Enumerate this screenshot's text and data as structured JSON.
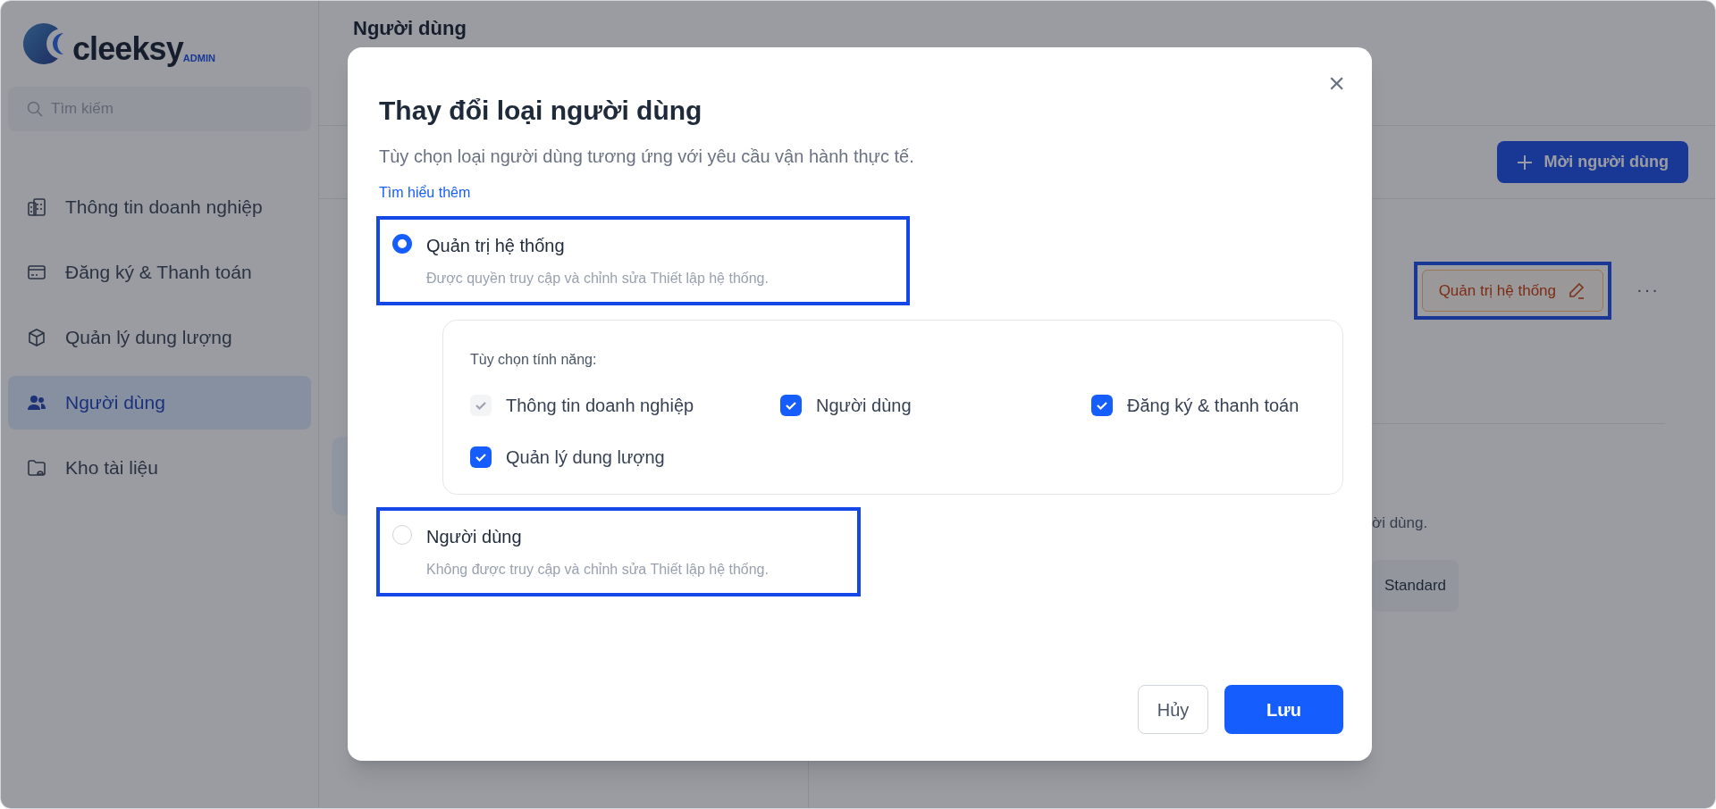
{
  "sidebar": {
    "logo": {
      "text": "cleeksy",
      "badge": "ADMIN"
    },
    "search": {
      "placeholder": "Tìm kiếm"
    },
    "items": [
      {
        "label": "Thông tin doanh nghiệp",
        "selected": false
      },
      {
        "label": "Đăng ký & Thanh toán",
        "selected": false
      },
      {
        "label": "Quản lý dung lượng",
        "selected": false
      },
      {
        "label": "Người dùng",
        "selected": true
      },
      {
        "label": "Kho tài liệu",
        "selected": false
      }
    ]
  },
  "page": {
    "title": "Người dùng",
    "invite_button": "Mời người dùng",
    "role_badge": {
      "label": "Quản trị hệ thống",
      "highlighted": true
    },
    "more_button": "···",
    "partial_text": "ời dùng.",
    "plan_chip": "Standard"
  },
  "dialog": {
    "title": "Thay đổi loại người dùng",
    "close": "×",
    "description": "Tùy chọn loại người dùng tương ứng với yêu cầu vận hành thực tế.",
    "link": "Tìm hiểu thêm",
    "options": [
      {
        "label": "Quản trị hệ thống",
        "description": "Được quyền truy cập và chỉnh sửa Thiết lập hệ thống.",
        "selected": true,
        "highlighted": true,
        "features": {
          "title": "Tùy chọn tính năng:",
          "items": [
            {
              "label": "Thông tin doanh nghiệp",
              "checked": true,
              "disabled": true
            },
            {
              "label": "Người dùng",
              "checked": true,
              "disabled": false
            },
            {
              "label": "Đăng ký & thanh toán",
              "checked": true,
              "disabled": false
            },
            {
              "label": "Quản lý dung lượng",
              "checked": true,
              "disabled": false
            }
          ]
        }
      },
      {
        "label": "Người dùng",
        "description": "Không được truy cập và chỉnh sửa Thiết lập hệ thống.",
        "selected": false,
        "highlighted": true
      }
    ],
    "buttons": {
      "cancel": "Hủy",
      "save": "Lưu"
    }
  }
}
